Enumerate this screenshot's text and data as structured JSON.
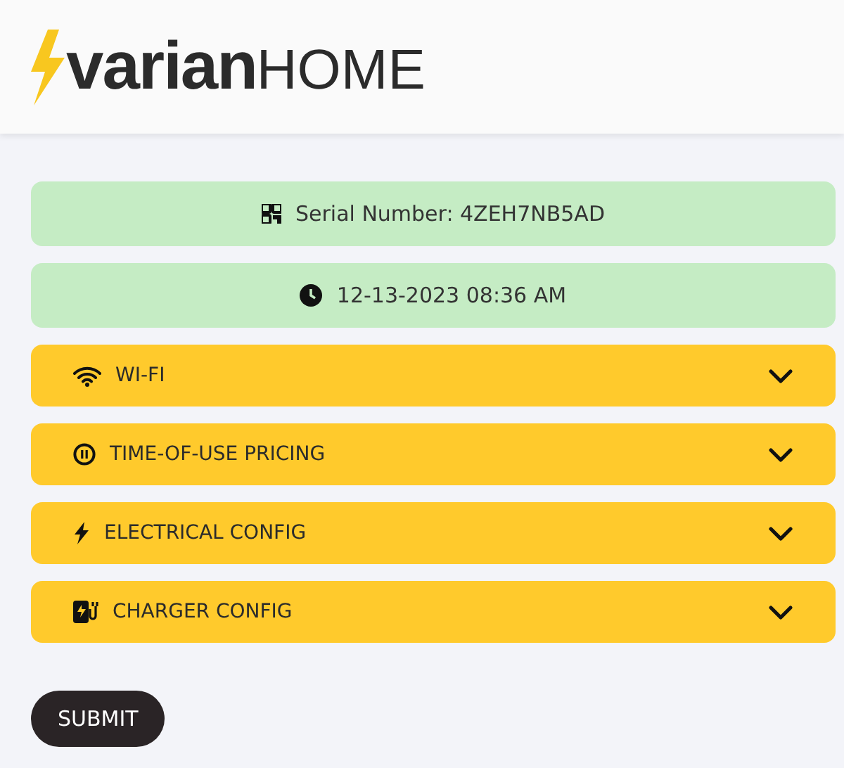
{
  "logo": {
    "primary": "varian",
    "secondary": "HOME"
  },
  "info": [
    {
      "kind": "qr",
      "text": "Serial Number: 4ZEH7NB5AD"
    },
    {
      "kind": "clock",
      "text": "12-13-2023 08:36 AM"
    }
  ],
  "sections": [
    {
      "kind": "wifi",
      "label": "WI-FI",
      "expanded": false
    },
    {
      "kind": "pricing",
      "label": "TIME-OF-USE PRICING",
      "expanded": false
    },
    {
      "kind": "bolt",
      "label": "ELECTRICAL CONFIG",
      "expanded": false
    },
    {
      "kind": "charger",
      "label": "CHARGER CONFIG",
      "expanded": false
    }
  ],
  "submit": "SUBMIT"
}
